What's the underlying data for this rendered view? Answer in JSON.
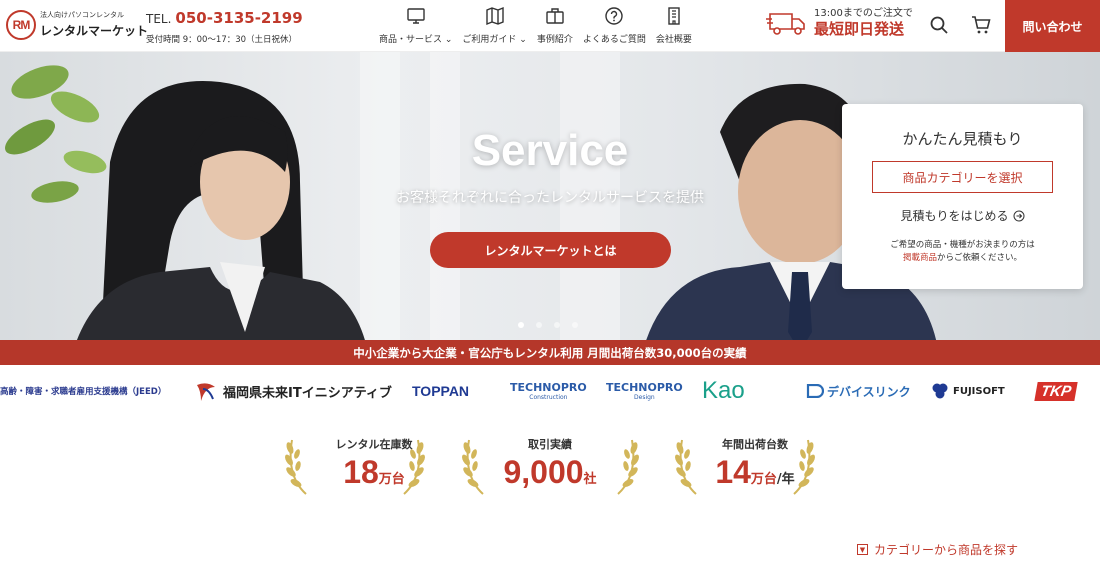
{
  "header": {
    "logo_mark": "RM",
    "logo_sub": "法人向けパソコンレンタル",
    "logo_main": "レンタルマーケット",
    "tel_label": "TEL.",
    "tel_number": "050-3135-2199",
    "tel_hours": "受付時間 9：00〜17：30（土日祝休）",
    "nav": [
      {
        "label": "商品・サービス ⌄",
        "icon": "monitor-icon"
      },
      {
        "label": "ご利用ガイド ⌄",
        "icon": "map-icon"
      },
      {
        "label": "事例紹介",
        "icon": "briefcase-icon"
      },
      {
        "label": "よくあるご質問",
        "icon": "question-icon"
      },
      {
        "label": "会社概要",
        "icon": "building-icon"
      }
    ],
    "ship_small": "13:00までのご注文で",
    "ship_big": "最短即日発送",
    "contact": "問い合わせ"
  },
  "hero": {
    "title": "Service",
    "subtitle": "お客様それぞれに合ったレンタルサービスを提供",
    "button": "レンタルマーケットとは",
    "slides": 4,
    "active_slide": 0
  },
  "estimate": {
    "title": "かんたん見積もり",
    "select": "商品カテゴリーを選択",
    "start": "見積もりをはじめる",
    "note_line1": "ご希望の商品・機種がお決まりの方は",
    "note_link": "掲載商品",
    "note_line2": "からご依頼ください。"
  },
  "banner": "中小企業から大企業・官公庁もレンタル利用 月間出荷台数30,000台の実績",
  "client_logos": [
    {
      "text": "高齢・障害・求職者雇用支援機構（JEED）",
      "color": "#2b3b8f"
    },
    {
      "text": "福岡県未来ITイニシアティブ",
      "color": "#222222"
    },
    {
      "text": "TOPPAN",
      "color": "#1f3a93"
    },
    {
      "text": "TECHNOPRO",
      "sub": "Construction",
      "color": "#2b5ba8"
    },
    {
      "text": "TECHNOPRO",
      "sub": "Design",
      "color": "#2b5ba8"
    },
    {
      "text": "Kao",
      "color": "#1aa08a"
    },
    {
      "text": "デバイスリンク",
      "color": "#2a6bb5"
    },
    {
      "text": "FUJISOFT",
      "color": "#222222"
    },
    {
      "text": "TKP",
      "color": "#d6312a"
    }
  ],
  "stats": [
    {
      "label": "レンタル在庫数",
      "value": "18",
      "unit": "万台",
      "suffix": ""
    },
    {
      "label": "取引実績",
      "value": "9,000",
      "unit": "社",
      "suffix": ""
    },
    {
      "label": "年間出荷台数",
      "value": "14",
      "unit": "万台",
      "suffix": "/年"
    }
  ],
  "category_link": "カテゴリーから商品を探す",
  "colors": {
    "accent": "#c0392b",
    "gold": "#d2b65a"
  }
}
